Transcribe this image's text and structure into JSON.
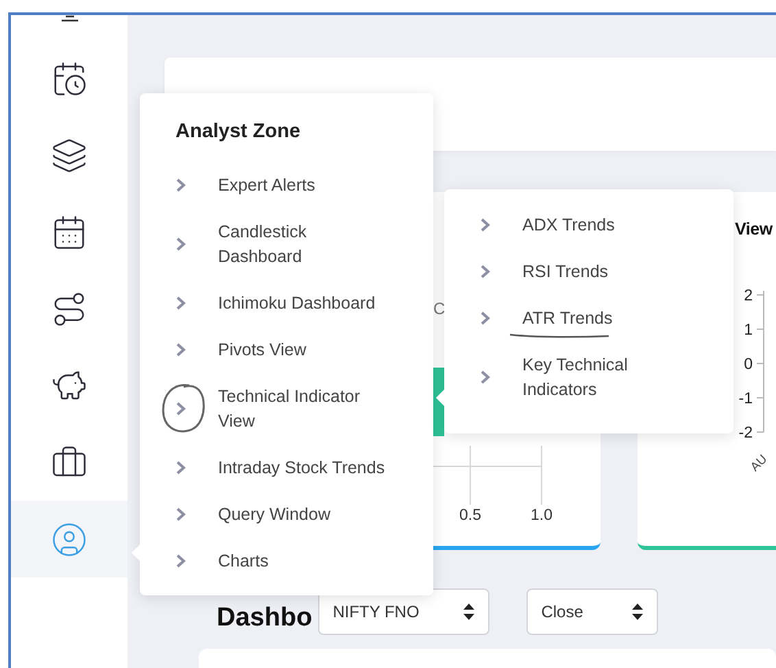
{
  "sidebar": {
    "items": [
      {
        "selected": false
      },
      {
        "selected": false
      },
      {
        "selected": false
      },
      {
        "selected": false
      },
      {
        "selected": false
      },
      {
        "selected": false
      },
      {
        "selected": true
      }
    ]
  },
  "left_card": {
    "axis_label": "C",
    "x_ticks": [
      "0.5",
      "1.0"
    ]
  },
  "right_card": {
    "title": "View",
    "y_ticks": [
      "2",
      "1",
      "0",
      "-1",
      "-2"
    ],
    "x_label": "AU"
  },
  "dashboard": {
    "heading": "Dashbo",
    "selects": [
      {
        "value": "NIFTY FNO"
      },
      {
        "value": "Close"
      }
    ]
  },
  "analyst_menu": {
    "title": "Analyst Zone",
    "items": [
      {
        "label": "Expert Alerts",
        "circled": false
      },
      {
        "label": "Candlestick Dashboard",
        "circled": false
      },
      {
        "label": "Ichimoku Dashboard",
        "circled": false
      },
      {
        "label": "Pivots View",
        "circled": false
      },
      {
        "label": "Technical Indicator View",
        "circled": true
      },
      {
        "label": "Intraday Stock Trends",
        "circled": false
      },
      {
        "label": "Query Window",
        "circled": false
      },
      {
        "label": "Charts",
        "circled": false
      }
    ]
  },
  "submenu": {
    "items": [
      {
        "label": "ADX Trends",
        "underlined": false
      },
      {
        "label": "RSI Trends",
        "underlined": false
      },
      {
        "label": "ATR Trends",
        "underlined": true
      },
      {
        "label": "Key Technical Indicators",
        "underlined": false
      }
    ]
  }
}
